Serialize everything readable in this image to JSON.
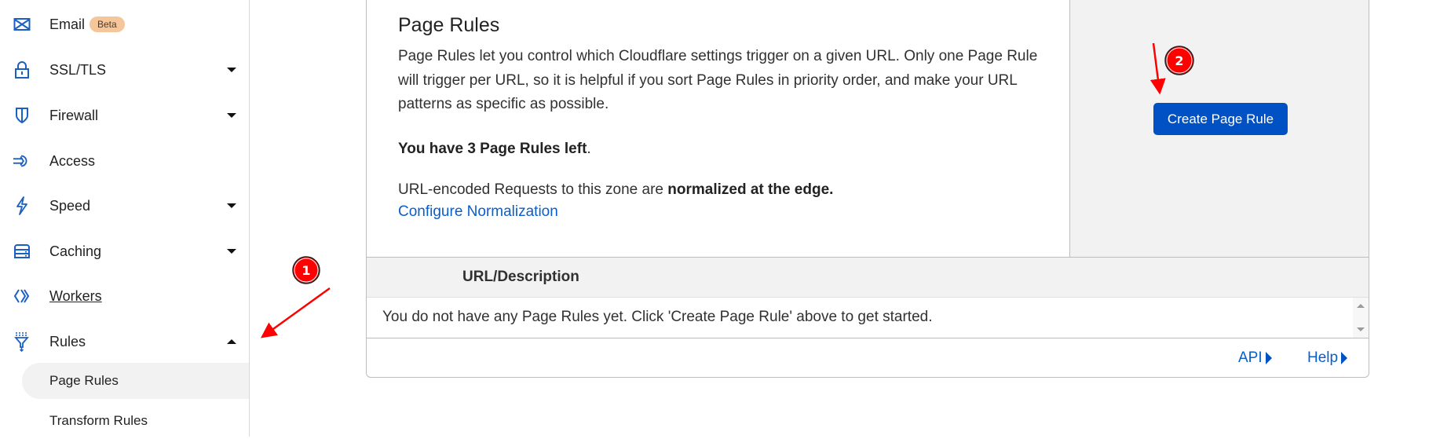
{
  "sidebar": {
    "items": [
      {
        "label": "Email",
        "icon": "envelope-icon",
        "badge": "Beta"
      },
      {
        "label": "SSL/TLS",
        "icon": "lock-icon",
        "caret": "down"
      },
      {
        "label": "Firewall",
        "icon": "shield-icon",
        "caret": "down"
      },
      {
        "label": "Access",
        "icon": "access-arrow-icon"
      },
      {
        "label": "Speed",
        "icon": "lightning-icon",
        "caret": "down"
      },
      {
        "label": "Caching",
        "icon": "server-stack-icon",
        "caret": "down"
      },
      {
        "label": "Workers",
        "icon": "workers-chevrons-icon"
      },
      {
        "label": "Rules",
        "icon": "filter-funnel-icon",
        "caret": "up"
      }
    ],
    "sub_items": [
      {
        "label": "Page Rules",
        "active": true
      },
      {
        "label": "Transform Rules",
        "active": false
      }
    ]
  },
  "card": {
    "title": "Page Rules",
    "description": "Page Rules let you control which Cloudflare settings trigger on a given URL. Only one Page Rule will trigger per URL, so it is helpful if you sort Page Rules in priority order, and make your URL patterns as specific as possible.",
    "rules_left_bold": "You have 3 Page Rules left",
    "rules_left_suffix": ".",
    "normalization_prefix": "URL-encoded Requests to this zone are ",
    "normalization_bold": "normalized at the edge.",
    "normalization_link": "Configure Normalization",
    "create_button": "Create Page Rule"
  },
  "table": {
    "column_header": "URL/Description",
    "empty_message": "You do not have any Page Rules yet. Click 'Create Page Rule' above to get started."
  },
  "footer": {
    "api_link": "API",
    "help_link": "Help"
  },
  "annotations": {
    "step1": "1",
    "step2": "2",
    "color": "#ff0000"
  }
}
